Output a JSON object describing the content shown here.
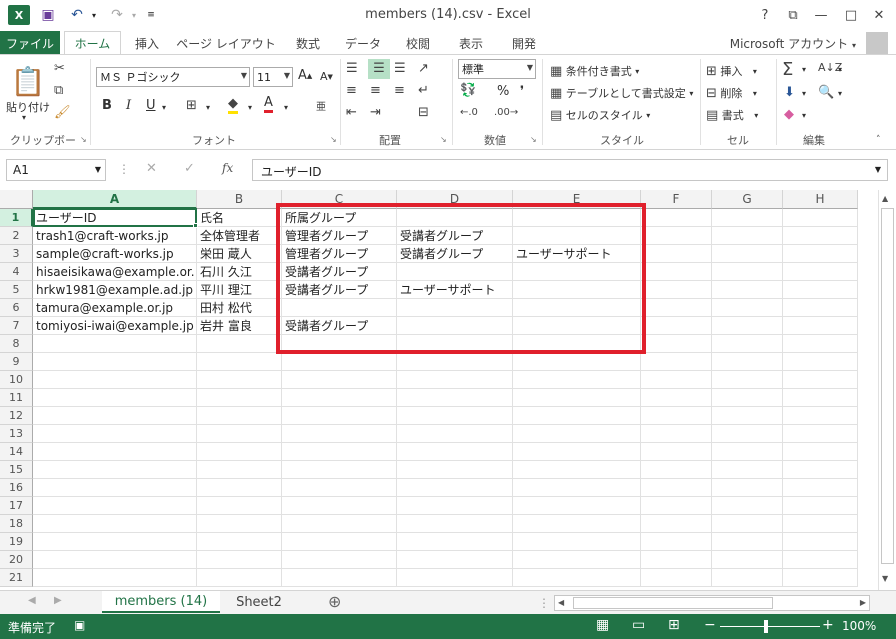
{
  "titlebar": {
    "title": "members (14).csv - Excel",
    "help": "?",
    "ribbon_display": "⧉",
    "minimize": "—",
    "maximize": "□",
    "close": "✕"
  },
  "tabs": {
    "file": "ファイル",
    "items": [
      "ホーム",
      "挿入",
      "ページ レイアウト",
      "数式",
      "データ",
      "校閲",
      "表示",
      "開発"
    ],
    "account": "Microsoft アカウント"
  },
  "ribbon": {
    "clipboard": {
      "paste": "貼り付け",
      "label": "クリップボード"
    },
    "font": {
      "name": "ＭＳ Ｐゴシック",
      "size": "11",
      "grow": "A",
      "shrink": "A",
      "bold": "B",
      "italic": "I",
      "underline": "U",
      "color_letter": "A",
      "label": "フォント"
    },
    "alignment": {
      "label": "配置"
    },
    "number": {
      "format": "標準",
      "percent": "%",
      "comma": "❜",
      "label": "数値"
    },
    "styles": {
      "conditional": "条件付き書式",
      "table": "テーブルとして書式設定",
      "cell": "セルのスタイル",
      "label": "スタイル"
    },
    "cells": {
      "insert": "挿入",
      "delete": "削除",
      "format": "書式",
      "label": "セル"
    },
    "editing": {
      "label": "編集"
    }
  },
  "formula_bar": {
    "name_box": "A1",
    "fx": "fx",
    "content": "ユーザーID"
  },
  "columns": [
    "A",
    "B",
    "C",
    "D",
    "E",
    "F",
    "G",
    "H"
  ],
  "rows": [
    "1",
    "2",
    "3",
    "4",
    "5",
    "6",
    "7",
    "8",
    "9",
    "10",
    "11",
    "12",
    "13",
    "14",
    "15",
    "16",
    "17",
    "18",
    "19",
    "20",
    "21"
  ],
  "cells": [
    [
      "ユーザーID",
      "氏名",
      "所属グループ",
      "",
      "",
      ""
    ],
    [
      "trash1@craft-works.jp",
      "全体管理者",
      "管理者グループ",
      "受講者グループ",
      "",
      ""
    ],
    [
      "sample@craft-works.jp",
      "栄田 蔵人",
      "管理者グループ",
      "受講者グループ",
      "ユーザーサポート",
      ""
    ],
    [
      "hisaeisikawa@example.or.",
      "石川 久江",
      "受講者グループ",
      "",
      "",
      ""
    ],
    [
      "hrkw1981@example.ad.jp",
      "平川 理江",
      "受講者グループ",
      "ユーザーサポート",
      "",
      ""
    ],
    [
      "tamura@example.or.jp",
      "田村 松代",
      "",
      "",
      "",
      ""
    ],
    [
      "tomiyosi-iwai@example.jp",
      "岩井 富良",
      "受講者グループ",
      "",
      "",
      ""
    ]
  ],
  "sheet_tabs": [
    "members (14)",
    "Sheet2"
  ],
  "add_sheet": "⊕",
  "status": {
    "ready": "準備完了",
    "zoom": "100%"
  },
  "colors": {
    "excel_green": "#217346",
    "highlight_red": "#e0202c"
  }
}
